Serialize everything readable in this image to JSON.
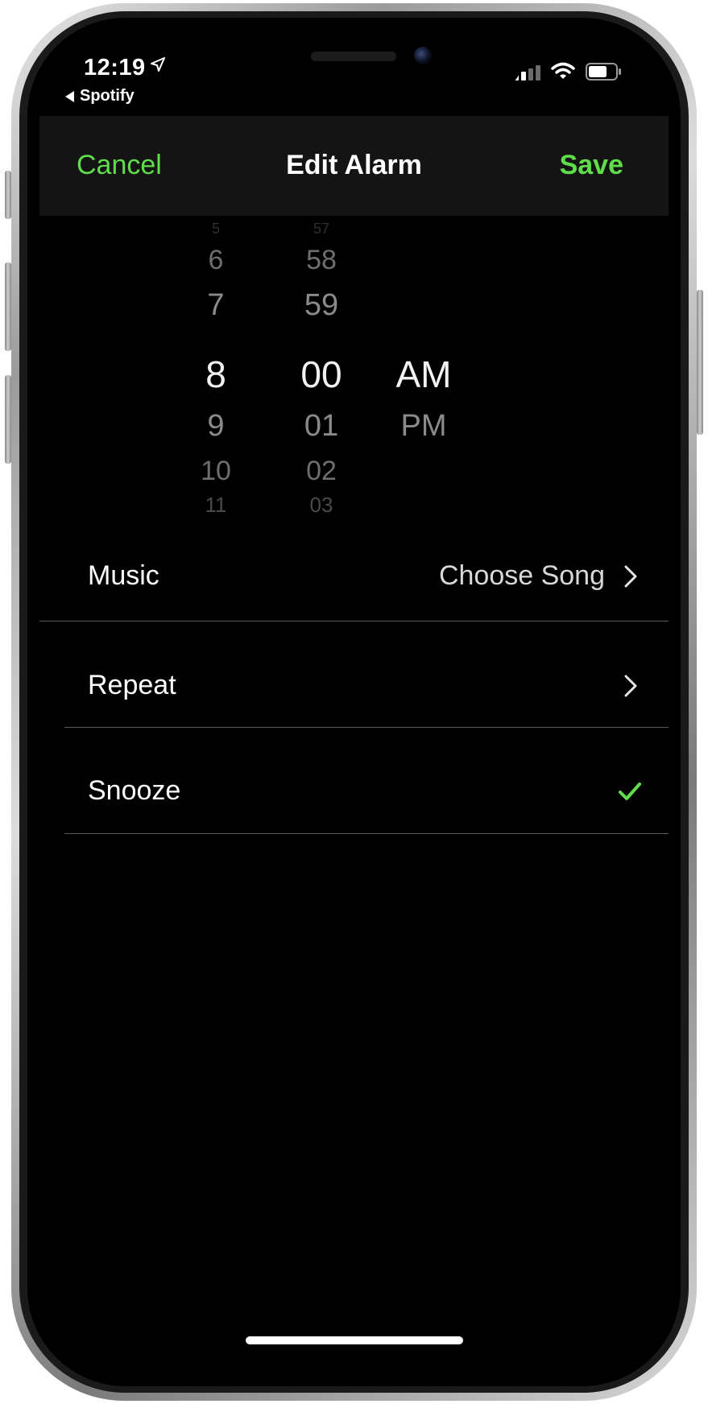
{
  "status_bar": {
    "time": "12:19",
    "back_app": "Spotify"
  },
  "nav": {
    "cancel": "Cancel",
    "title": "Edit Alarm",
    "save": "Save"
  },
  "picker": {
    "hours": {
      "above": [
        "5",
        "6",
        "7"
      ],
      "selected": "8",
      "below": [
        "9",
        "10",
        "11"
      ]
    },
    "minutes": {
      "above": [
        "57",
        "58",
        "59"
      ],
      "selected": "00",
      "below": [
        "01",
        "02",
        "03"
      ]
    },
    "period": {
      "selected": "AM",
      "below": [
        "PM"
      ]
    }
  },
  "settings": {
    "music": {
      "label": "Music",
      "value": "Choose Song"
    },
    "repeat": {
      "label": "Repeat"
    },
    "snooze": {
      "label": "Snooze",
      "checked": true
    }
  },
  "colors": {
    "accent": "#5fdd4a",
    "navbar": "#141414",
    "background": "#000000"
  },
  "icons": [
    "location-arrow-icon",
    "back-triangle-icon",
    "signal-icon",
    "wifi-icon",
    "battery-icon",
    "chevron-right-icon",
    "checkmark-icon"
  ]
}
